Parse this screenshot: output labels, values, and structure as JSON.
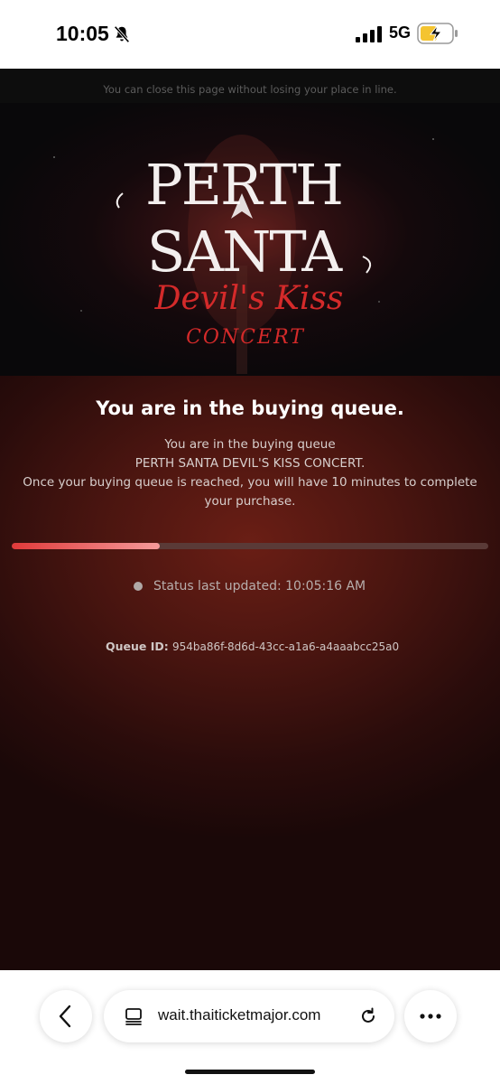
{
  "status_bar": {
    "time": "10:05",
    "network": "5G"
  },
  "notice": "You can close this page without losing your place in line.",
  "logo": {
    "line1": "PERTH",
    "line2": "SANTA",
    "line3": "Devil's Kiss",
    "line4": "CONCERT"
  },
  "queue": {
    "title": "You are in the buying queue.",
    "lines": [
      "You are in the buying queue",
      "PERTH SANTA DEVIL'S KISS CONCERT.",
      "Once your buying queue is reached, you will have 10 minutes to complete",
      "your purchase."
    ],
    "progress_percent": 31,
    "status": "Status last updated: 10:05:16 AM",
    "queue_id_label": "Queue ID:",
    "queue_id_value": "954ba86f-8d6d-43cc-a1a6-a4aaabcc25a0"
  },
  "browser": {
    "url": "wait.thaiticketmajor.com"
  },
  "colors": {
    "accent_red": "#e03a3a",
    "logo_red": "#d42a2a",
    "page_bg": "#2a0c0b"
  },
  "icons": [
    "bell-slash-icon",
    "signal-icon",
    "battery-charging-icon",
    "back-icon",
    "tabs-icon",
    "reload-icon",
    "more-icon"
  ]
}
